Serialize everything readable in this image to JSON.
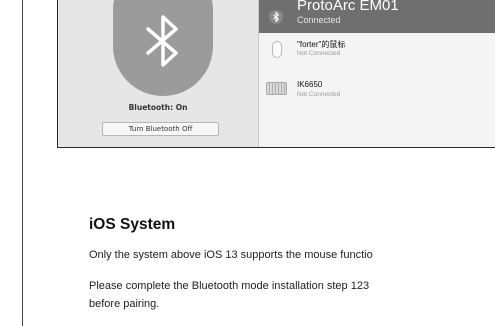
{
  "bluetooth_panel": {
    "status_label": "Bluetooth: On",
    "toggle_button_label": "Turn Bluetooth Off",
    "devices": [
      {
        "name": "ProtoArc EM01",
        "status": "Connected",
        "icon": "bluetooth-icon",
        "selected": true
      },
      {
        "name": "\"forter\"的鼠标",
        "status": "Not Connected",
        "icon": "mouse-icon",
        "selected": false
      },
      {
        "name": "IK6650",
        "status": "Not Connected",
        "icon": "keyboard-icon",
        "selected": false
      }
    ],
    "colors": {
      "selected_row": "#6f6f6f",
      "bluetooth_circle": "#9b9b9b"
    }
  },
  "section": {
    "title": "iOS System",
    "paragraph_1": "Only the system above iOS 13 supports the mouse functio",
    "paragraph_2_line_1": "Please complete the Bluetooth mode installation step 123",
    "paragraph_2_line_2": "before pairing."
  }
}
